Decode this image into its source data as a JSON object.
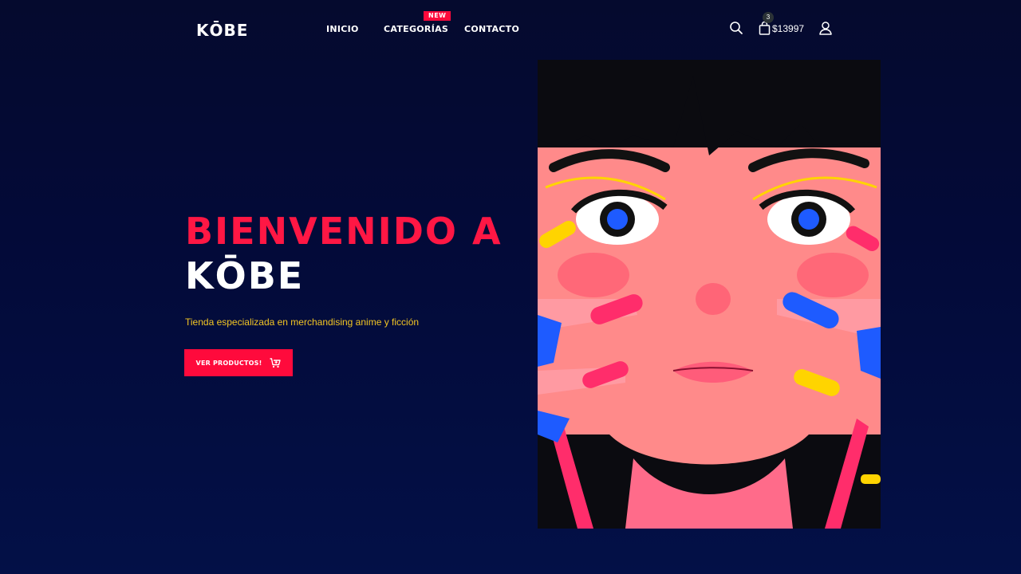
{
  "brand": {
    "logo": "KŌBE"
  },
  "nav": {
    "items": [
      {
        "label": "INICIO"
      },
      {
        "label": "CATEGORÍAS"
      },
      {
        "label": "CONTACTO"
      }
    ],
    "new_badge": "NEW"
  },
  "header_actions": {
    "search_icon": "search-icon",
    "cart_icon": "shopping-bag-icon",
    "cart_count": "3",
    "cart_total": "$13997",
    "user_icon": "user-icon"
  },
  "hero": {
    "title_line1": "BIENVENIDO A",
    "title_line2": "KŌBE",
    "subtitle": "Tienda especializada en merchandising anime y ficción",
    "cta_label": "VER PRODUCTOS!",
    "cta_icon": "cart-plus-icon",
    "image": "anime-girl-illustration"
  },
  "colors": {
    "background": "#030a38",
    "accent": "#ff0a3c",
    "subtitle": "#f3c623",
    "text": "#ffffff"
  }
}
